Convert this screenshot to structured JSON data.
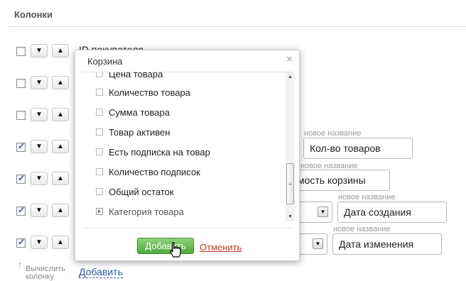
{
  "section": {
    "title": "Колонки"
  },
  "rows": [
    {
      "checked": false,
      "label": "ID покупателя"
    },
    {
      "checked": false
    },
    {
      "checked": false
    },
    {
      "checked": true,
      "caption": "новое название",
      "value": "Кол-во товаров"
    },
    {
      "checked": true,
      "caption": "новое название",
      "value": "Стоимость корзины"
    },
    {
      "checked": true,
      "caption": "новое название",
      "value": "Дата создания"
    },
    {
      "checked": true,
      "caption": "новое название",
      "value": "Дата изменения"
    }
  ],
  "footer": {
    "add_label": "Добавить",
    "calc_hint": "Вычислить колонку"
  },
  "dialog": {
    "title": "Корзина",
    "close": "×",
    "items": [
      {
        "label": "Цена товара",
        "type": "checkbox"
      },
      {
        "label": "Количество товара",
        "type": "checkbox"
      },
      {
        "label": "Сумма товара",
        "type": "checkbox"
      },
      {
        "label": "Товар активен",
        "type": "checkbox"
      },
      {
        "label": "Есть подписка на товар",
        "type": "checkbox"
      },
      {
        "label": "Количество подписок",
        "type": "checkbox"
      },
      {
        "label": "Общий остаток",
        "type": "checkbox"
      },
      {
        "label": "Категория товара",
        "type": "group"
      }
    ],
    "add_button": "Добавить",
    "cancel_link": "Отменить"
  },
  "icons": {
    "move_down": "chevron-down-icon",
    "move_up": "chevron-up-icon",
    "select_arrow": "dropdown-arrow-icon",
    "calc_arrow": "arrow-up-icon",
    "cursor": "hand-pointer-icon"
  },
  "colors": {
    "accent_link": "#2b5aa6",
    "add_button": "#4fa93a",
    "cancel_link": "#c0392b"
  }
}
